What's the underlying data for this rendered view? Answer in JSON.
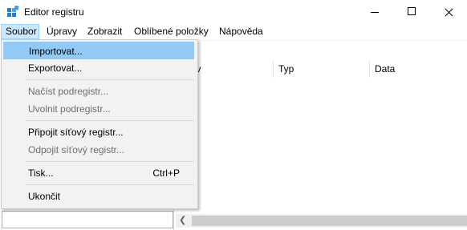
{
  "window": {
    "title": "Editor registru",
    "icon": "regedit-icon"
  },
  "menubar": {
    "items": [
      "Soubor",
      "Úpravy",
      "Zobrazit",
      "Oblíbené položky",
      "Nápověda"
    ]
  },
  "columns": [
    "ázev",
    "Typ",
    "Data"
  ],
  "file_menu": {
    "items": [
      {
        "label": "Importovat...",
        "enabled": true,
        "highlighted": true
      },
      {
        "label": "Exportovat...",
        "enabled": true
      },
      {
        "label": "Načíst podregistr...",
        "enabled": false
      },
      {
        "label": "Uvolnit podregistr...",
        "enabled": false
      },
      {
        "label": "Připojit síťový registr...",
        "enabled": true
      },
      {
        "label": "Odpojit síťový registr...",
        "enabled": false
      },
      {
        "label": "Tisk...",
        "shortcut": "Ctrl+P",
        "enabled": true
      },
      {
        "label": "Ukončit",
        "enabled": true
      }
    ]
  },
  "colors": {
    "highlight": "#91c9f7",
    "menu_active": "#cce8ff",
    "disabled_text": "#6d6d6d"
  }
}
